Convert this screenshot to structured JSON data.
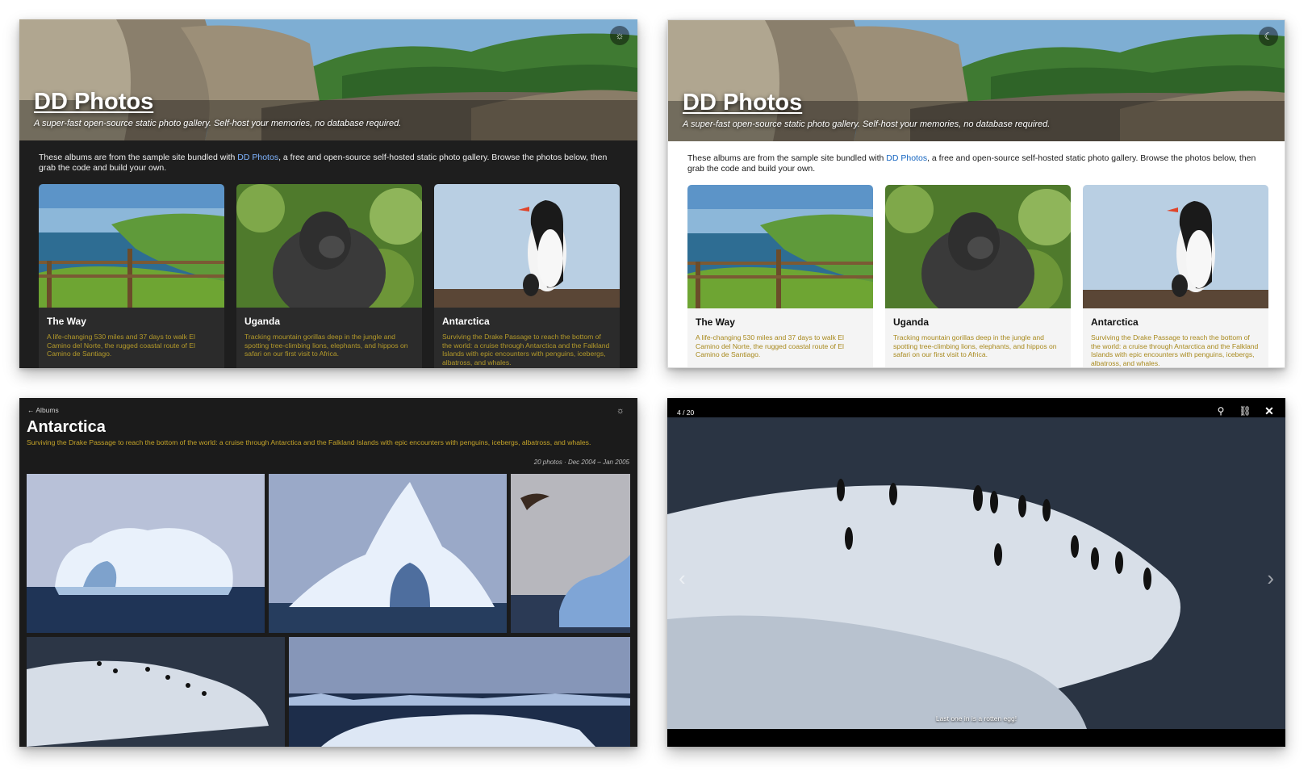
{
  "home": {
    "title": "DD Photos",
    "tagline": "A super-fast open-source static photo gallery. Self-host your memories, no database required.",
    "intro_before": "These albums are from the sample site bundled with ",
    "intro_link": "DD Photos",
    "intro_after": ", a free and open-source self-hosted static photo gallery. Browse the photos below, then grab the code and build your own.",
    "theme_icon_dark_mode": "sun-icon",
    "theme_icon_light_mode": "moon-icon",
    "albums": [
      {
        "title": "The Way",
        "description": "A life-changing 530 miles and 37 days to walk El Camino del Norte, the rugged coastal route of El Camino de Santiago."
      },
      {
        "title": "Uganda",
        "description": "Tracking mountain gorillas deep in the jungle and spotting tree-climbing lions, elephants, and hippos on safari on our first visit to Africa."
      },
      {
        "title": "Antarctica",
        "description": "Surviving the Drake Passage to reach the bottom of the world: a cruise through Antarctica and the Falkland Islands with epic encounters with penguins, icebergs, albatross, and whales."
      }
    ]
  },
  "album": {
    "back_label": "← Albums",
    "title": "Antarctica",
    "description": "Surviving the Drake Passage to reach the bottom of the world: a cruise through Antarctica and the Falkland Islands with epic encounters with penguins, icebergs, albatross, and whales.",
    "meta": "20 photos · Dec 2004 – Jan 2005",
    "theme_icon": "sun-icon"
  },
  "lightbox": {
    "counter": "4 / 20",
    "caption": "Last one in is a rotten egg!",
    "icons": [
      "zoom-icon",
      "link-icon",
      "close-icon"
    ]
  },
  "colors": {
    "dark_bg": "#1e1e1e",
    "description_gold": "#b49a2a",
    "link_blue_dark": "#7fb4ff",
    "link_blue_light": "#1565c0"
  }
}
